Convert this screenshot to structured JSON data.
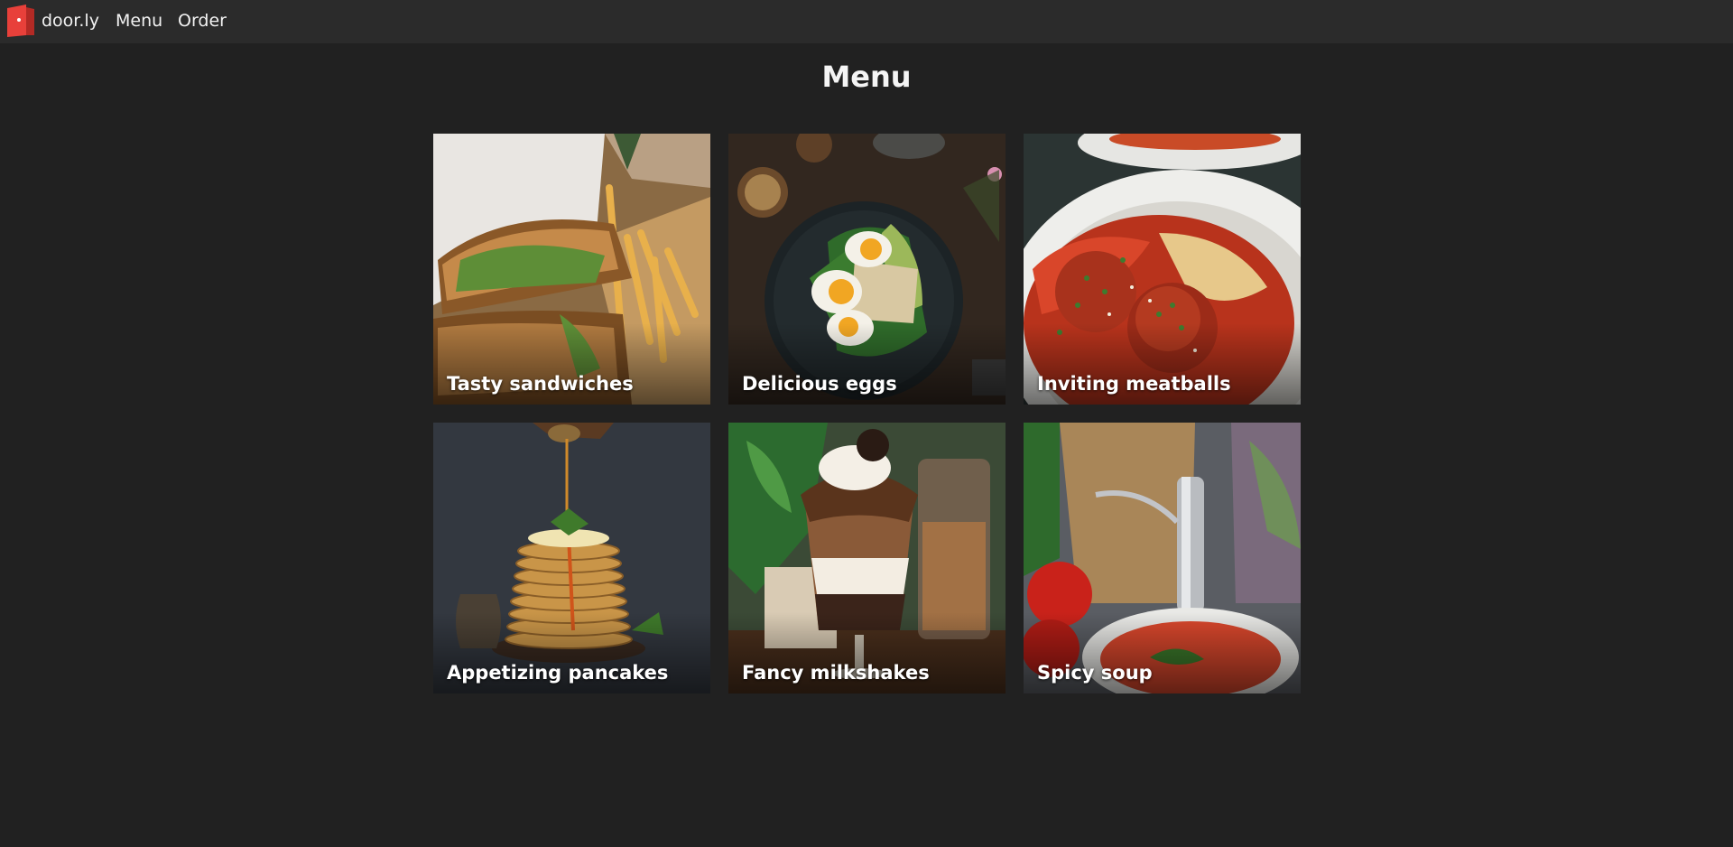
{
  "nav": {
    "brand": "door.ly",
    "links": [
      {
        "label": "Menu"
      },
      {
        "label": "Order"
      }
    ],
    "logo_icon": "door-logo-icon"
  },
  "page": {
    "title": "Menu"
  },
  "menu_items": [
    {
      "label": "Tasty sandwiches",
      "image": "sandwich-and-fries-photo"
    },
    {
      "label": "Delicious eggs",
      "image": "eggs-avocado-toast-photo"
    },
    {
      "label": "Inviting meatballs",
      "image": "spaghetti-meatballs-photo"
    },
    {
      "label": "Appetizing pancakes",
      "image": "pancake-stack-photo"
    },
    {
      "label": "Fancy milkshakes",
      "image": "chocolate-milkshake-photo"
    },
    {
      "label": "Spicy soup",
      "image": "tomato-soup-photo"
    }
  ],
  "colors": {
    "background": "#212121",
    "topbar": "#2b2b2b",
    "logo_red": "#e8403a"
  }
}
